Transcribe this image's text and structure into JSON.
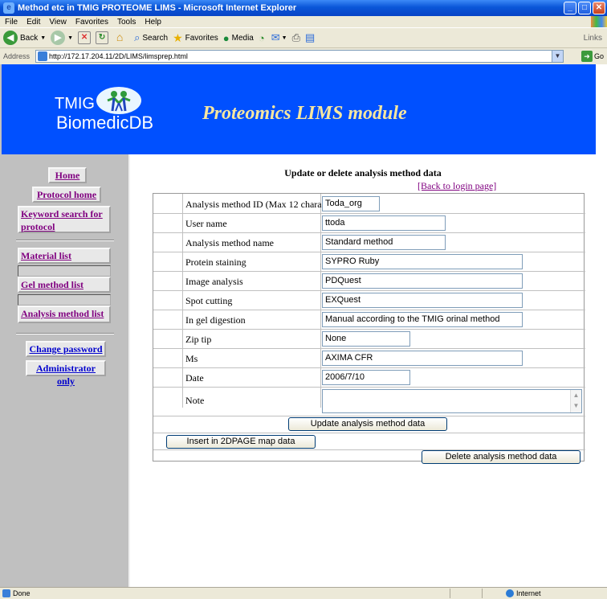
{
  "window": {
    "title": "Method etc in TMIG PROTEOME LIMS - Microsoft Internet Explorer"
  },
  "menu": [
    "File",
    "Edit",
    "View",
    "Favorites",
    "Tools",
    "Help"
  ],
  "toolbar": {
    "back": "Back",
    "search": "Search",
    "favorites": "Favorites",
    "media": "Media",
    "links": "Links"
  },
  "address": {
    "label": "Address",
    "url": "http://172.17.204.11/2D/LIMS/limsprep.html",
    "go": "Go"
  },
  "banner": {
    "logo_line1": "TMIG",
    "logo_line2": "BiomedicDB",
    "title": "Proteomics LIMS module"
  },
  "sidebar": {
    "home": "Home",
    "protocol_home": "Protocol home",
    "keyword_search_line1": "Keyword search for",
    "keyword_search_line2": "protocol",
    "material_list": "Material list",
    "gel_method_list": "Gel method list",
    "analysis_method_list": "Analysis method list",
    "change_password": "Change password",
    "administrator_only": "Administrator only"
  },
  "main": {
    "title": "Update or delete analysis method data",
    "back_link": "[Back to login page]",
    "fields": {
      "method_id": {
        "label": "Analysis method ID (Max 12 chara)",
        "value": "Toda_org"
      },
      "user_name": {
        "label": "User name",
        "value": "ttoda"
      },
      "method_name": {
        "label": "Analysis method name",
        "value": "Standard method"
      },
      "protein_staining": {
        "label": "Protein staining",
        "value": "SYPRO Ruby"
      },
      "image_analysis": {
        "label": "Image analysis",
        "value": "PDQuest"
      },
      "spot_cutting": {
        "label": "Spot cutting",
        "value": "EXQuest"
      },
      "in_gel_digestion": {
        "label": "In gel digestion",
        "value": "Manual according to the TMIG orinal method"
      },
      "zip_tip": {
        "label": "Zip tip",
        "value": "None"
      },
      "ms": {
        "label": "Ms",
        "value": "AXIMA CFR"
      },
      "date": {
        "label": "Date",
        "value": "2006/7/10"
      },
      "note": {
        "label": "Note",
        "value": ""
      }
    },
    "buttons": {
      "update": "Update analysis method data",
      "insert": "Insert in 2DPAGE map data",
      "delete": "Delete analysis method data"
    }
  },
  "status": {
    "text": "Done",
    "zone": "Internet"
  }
}
